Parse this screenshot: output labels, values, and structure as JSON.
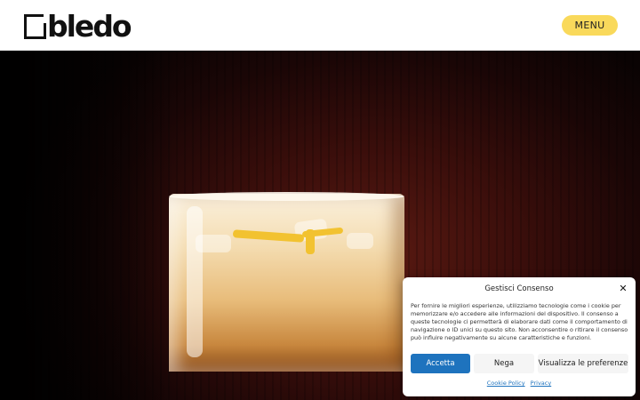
{
  "header": {
    "logo_text": "bledo",
    "menu_label": "MENU"
  },
  "hero": {
    "image": "cocktail-glass-with-lemon-twist"
  },
  "consent": {
    "title": "Gestisci Consenso",
    "body": "Per fornire le migliori esperienze, utilizziamo tecnologie come i cookie per memorizzare e/o accedere alle informazioni del dispositivo. Il consenso a queste tecnologie ci permetterà di elaborare dati come il comportamento di navigazione o ID unici su questo sito. Non acconsentire o ritirare il consenso può influire negativamente su alcune caratteristiche e funzioni.",
    "accept_label": "Accetta",
    "deny_label": "Nega",
    "prefs_label": "Visualizza le preferenze",
    "cookie_policy_label": "Cookie Policy",
    "privacy_label": "Privacy"
  },
  "colors": {
    "menu_button": "#f9d95b",
    "accept_button": "#1e73be",
    "link": "#1e73be"
  }
}
